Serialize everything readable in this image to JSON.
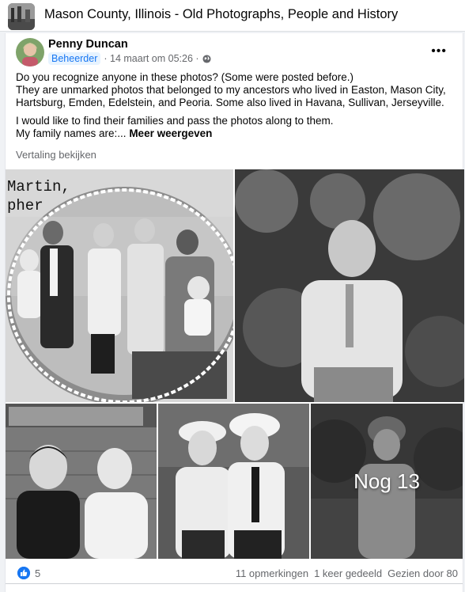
{
  "group": {
    "title": "Mason County, Illinois - Old Photographs, People and History"
  },
  "post": {
    "author": "Penny Duncan",
    "role_badge": "Beheerder",
    "timestamp": "· 14 maart om 05:26 ·",
    "text": {
      "p1": "Do you recognize anyone in these photos? (Some were posted before.)\nThey are unmarked photos that belonged to my ancestors who lived in Easton, Mason City, Hartsburg, Emden, Edelstein, and Peoria. Some also lived in Havana, Sullivan, Jerseyville.",
      "p2": "I would like to find their families and pass the photos along to them.\nMy family names are:...",
      "see_more": "Meer weergeven"
    },
    "translate_link": "Vertaling bekijken",
    "photos": {
      "photo1_caption": "Martin,\npher",
      "more_overlay": "Nog 13"
    },
    "footer": {
      "reaction_count": "5",
      "comments": "11 opmerkingen",
      "shares": "1 keer gedeeld",
      "views": "Gezien door 80"
    }
  },
  "colors": {
    "accent": "#1877f2",
    "secondary_text": "#65676b",
    "badge_bg": "#e7f3ff"
  },
  "icons": [
    "more-options-icon",
    "globe-icon",
    "like-reaction-icon"
  ]
}
